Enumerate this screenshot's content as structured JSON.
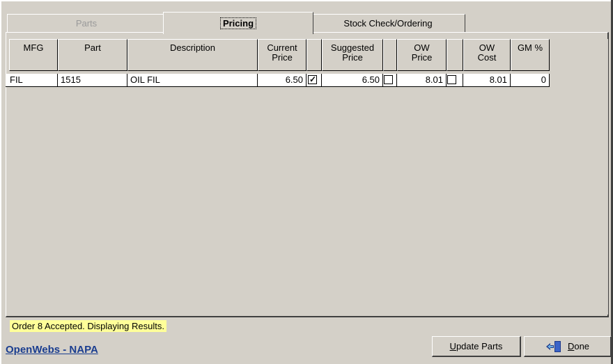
{
  "tabs": [
    {
      "label": "Parts",
      "state": "inactive"
    },
    {
      "label": "Pricing",
      "state": "active"
    },
    {
      "label": "Stock Check/Ordering",
      "state": "inactive"
    }
  ],
  "grid": {
    "headers": {
      "mfg": "MFG",
      "part": "Part",
      "description": "Description",
      "current_price_1": "Current",
      "current_price_2": "Price",
      "suggested_price_1": "Suggested",
      "suggested_price_2": "Price",
      "ow_price_1": "OW",
      "ow_price_2": "Price",
      "ow_cost_1": "OW",
      "ow_cost_2": "Cost",
      "gm": "GM %"
    },
    "rows": [
      {
        "mfg": "FIL",
        "part": "1515",
        "description": "OIL FIL",
        "current_price": "6.50",
        "current_checked": true,
        "suggested_price": "6.50",
        "suggested_checked": false,
        "ow_price": "8.01",
        "ow_checked": false,
        "ow_cost": "8.01",
        "gm": "0"
      }
    ]
  },
  "status": {
    "message": "Order 8 Accepted.  Displaying Results."
  },
  "footer": {
    "link": "OpenWebs - NAPA"
  },
  "buttons": {
    "update_prefix": "U",
    "update_rest": "pdate Parts",
    "done_prefix": "D",
    "done_rest": "one"
  },
  "icons": {
    "done": "exit-door-icon"
  },
  "colors": {
    "status_bg": "#ffff99",
    "link": "#1a3d8f",
    "window_bg": "#d4d0c8"
  }
}
